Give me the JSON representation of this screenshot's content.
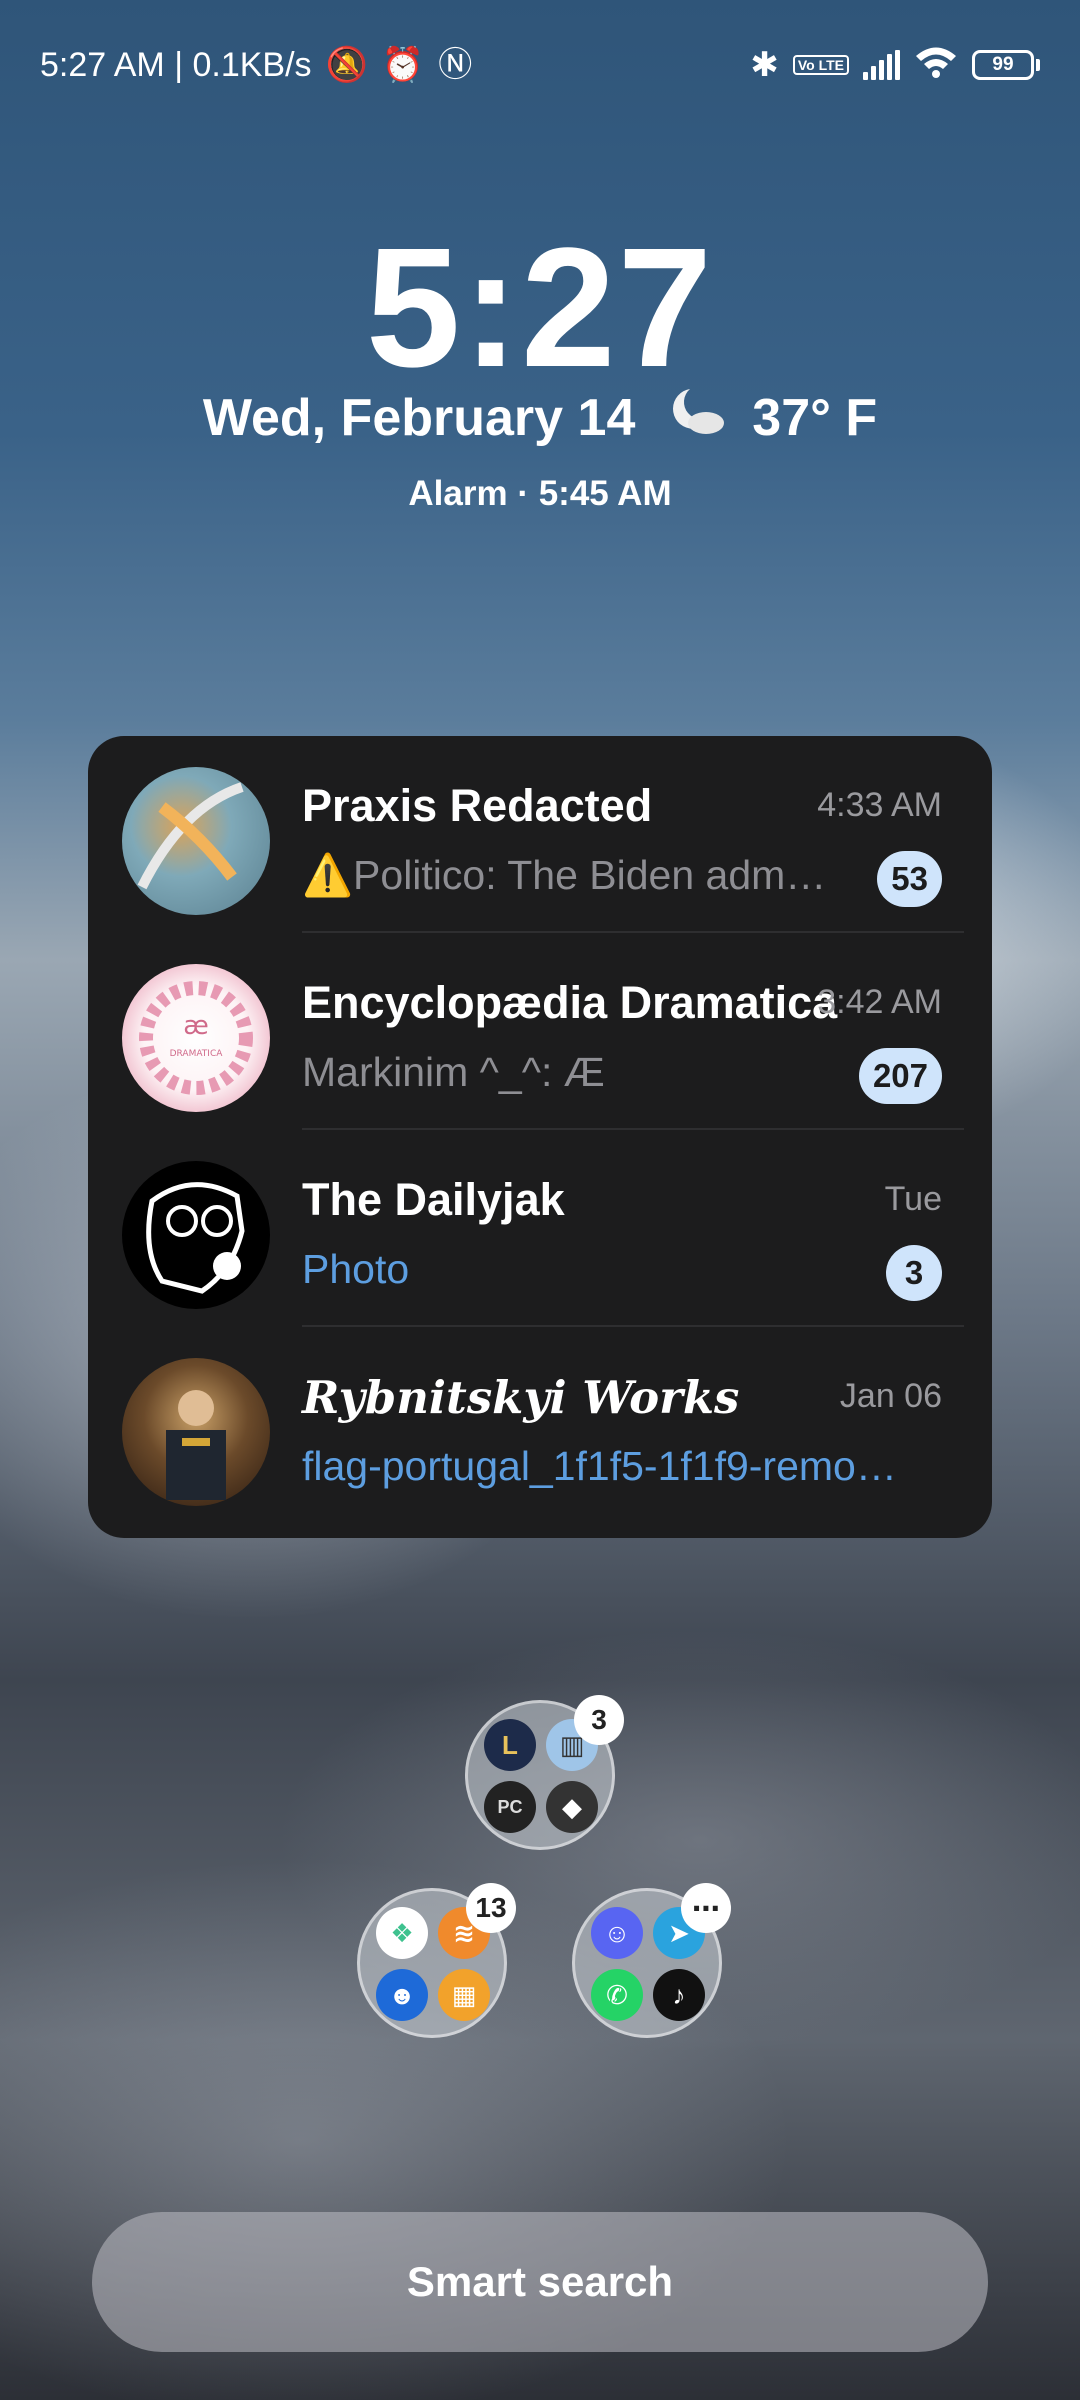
{
  "status_bar": {
    "left_text": "5:27 AM | 0.1KB/s",
    "icons_left": [
      "mute-icon",
      "alarm-icon",
      "nfc-icon"
    ],
    "icons_right": [
      "bluetooth-icon",
      "volte-icon",
      "signal-icon",
      "wifi-icon"
    ],
    "volte_label": "Vo LTE",
    "battery": "99"
  },
  "lockscreen": {
    "time": "5:27",
    "date": "Wed, February 14",
    "weather_icon": "moon-cloud-icon",
    "temperature": "37° F",
    "alarm": "Alarm · 5:45 AM"
  },
  "widget": {
    "chats": [
      {
        "name": "Praxis Redacted",
        "time": "4:33 AM",
        "preview": "⚠️Politico: The Biden adm…",
        "badge": "53"
      },
      {
        "name": "Encyclopædia Dramatica",
        "time": "3:42 AM",
        "preview": "Markinim ^_^: Æ",
        "badge": "207"
      },
      {
        "name": "The Dailyjak",
        "time": "Tue",
        "preview": "Photo",
        "badge": "3"
      },
      {
        "name": "Rybnitskyi Works",
        "time": "Jan 06",
        "preview": "flag-portugal_1f1f5-1f1f9-remo…",
        "badge": ""
      }
    ]
  },
  "folders": {
    "top": {
      "badge": "3"
    },
    "left": {
      "badge": "13"
    },
    "right": {
      "badge": "⋯"
    }
  },
  "smart_search": {
    "label": "Smart search"
  },
  "colors": {
    "widget_bg": "#1c1c1d",
    "badge_bg": "#cfe4fb",
    "link": "#5d9ee0"
  }
}
